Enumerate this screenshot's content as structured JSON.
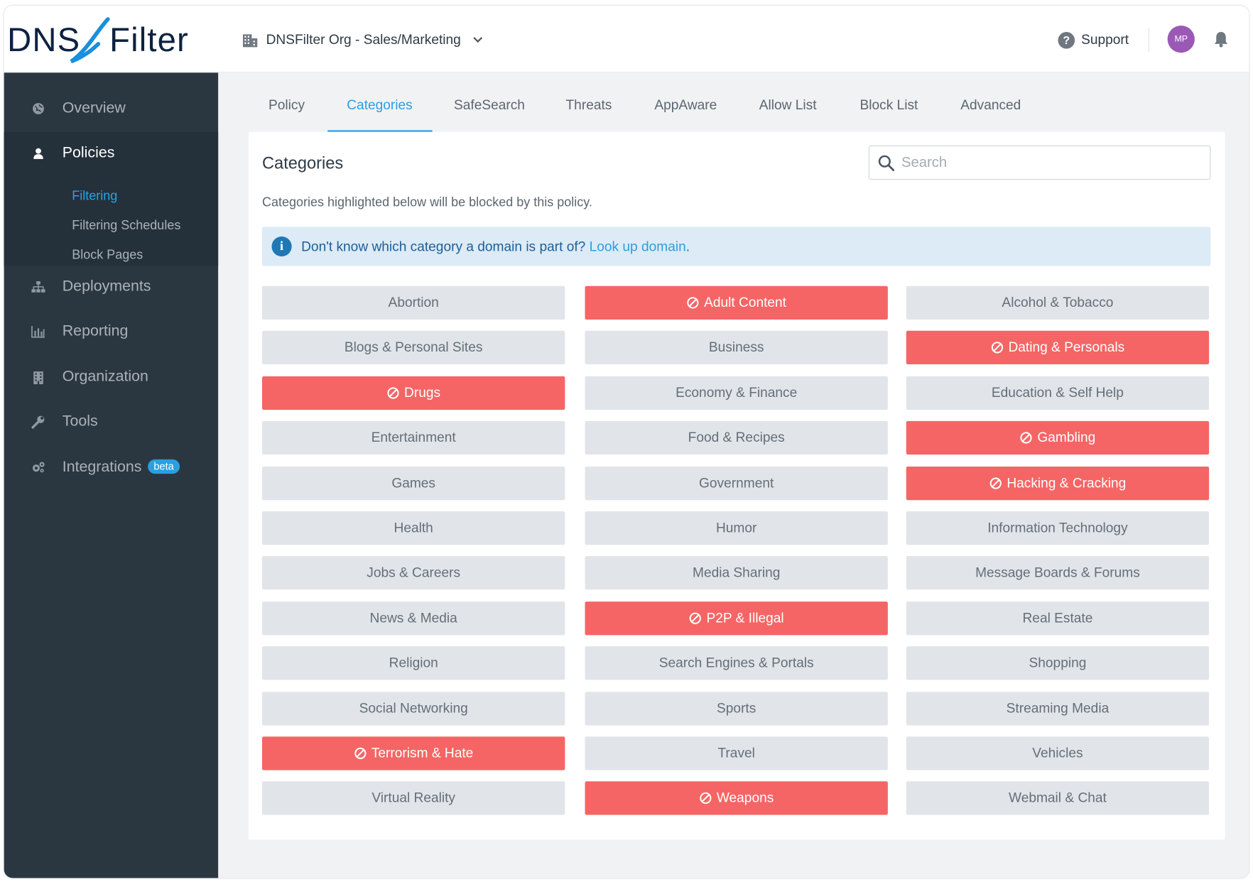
{
  "header": {
    "logo_text": "DNSFilter",
    "org_name": "DNSFilter Org - Sales/Marketing",
    "support_label": "Support",
    "avatar_initials": "MP",
    "avatar_color": "#9b59b6"
  },
  "sidebar": {
    "items": [
      {
        "label": "Overview",
        "icon": "globe-icon"
      },
      {
        "label": "Policies",
        "icon": "user-icon"
      },
      {
        "label": "Deployments",
        "icon": "sitemap-icon"
      },
      {
        "label": "Reporting",
        "icon": "bar-chart-icon"
      },
      {
        "label": "Organization",
        "icon": "building-icon"
      },
      {
        "label": "Tools",
        "icon": "wrench-icon"
      },
      {
        "label": "Integrations",
        "icon": "cogs-icon",
        "badge": "beta"
      }
    ],
    "sub_items": [
      "Filtering",
      "Filtering Schedules",
      "Block Pages"
    ],
    "active_item": "Policies",
    "active_sub_item": "Filtering"
  },
  "tabs": [
    "Policy",
    "Categories",
    "SafeSearch",
    "Threats",
    "AppAware",
    "Allow List",
    "Block List",
    "Advanced"
  ],
  "active_tab": "Categories",
  "main": {
    "title": "Categories",
    "search_placeholder": "Search",
    "description": "Categories highlighted below will be blocked by this policy.",
    "info_text": "Don't know which category a domain is part of?",
    "info_link": "Look up domain",
    "info_period": "."
  },
  "colors": {
    "accent": "#2a9fe1",
    "blocked": "#f56565",
    "sidebar": "#2b3740"
  },
  "categories": [
    {
      "label": "Abortion",
      "blocked": false
    },
    {
      "label": "Adult Content",
      "blocked": true
    },
    {
      "label": "Alcohol & Tobacco",
      "blocked": false
    },
    {
      "label": "Blogs & Personal Sites",
      "blocked": false
    },
    {
      "label": "Business",
      "blocked": false
    },
    {
      "label": "Dating & Personals",
      "blocked": true
    },
    {
      "label": "Drugs",
      "blocked": true
    },
    {
      "label": "Economy & Finance",
      "blocked": false
    },
    {
      "label": "Education & Self Help",
      "blocked": false
    },
    {
      "label": "Entertainment",
      "blocked": false
    },
    {
      "label": "Food & Recipes",
      "blocked": false
    },
    {
      "label": "Gambling",
      "blocked": true
    },
    {
      "label": "Games",
      "blocked": false
    },
    {
      "label": "Government",
      "blocked": false
    },
    {
      "label": "Hacking & Cracking",
      "blocked": true
    },
    {
      "label": "Health",
      "blocked": false
    },
    {
      "label": "Humor",
      "blocked": false
    },
    {
      "label": "Information Technology",
      "blocked": false
    },
    {
      "label": "Jobs & Careers",
      "blocked": false
    },
    {
      "label": "Media Sharing",
      "blocked": false
    },
    {
      "label": "Message Boards & Forums",
      "blocked": false
    },
    {
      "label": "News & Media",
      "blocked": false
    },
    {
      "label": "P2P & Illegal",
      "blocked": true
    },
    {
      "label": "Real Estate",
      "blocked": false
    },
    {
      "label": "Religion",
      "blocked": false
    },
    {
      "label": "Search Engines & Portals",
      "blocked": false
    },
    {
      "label": "Shopping",
      "blocked": false
    },
    {
      "label": "Social Networking",
      "blocked": false
    },
    {
      "label": "Sports",
      "blocked": false
    },
    {
      "label": "Streaming Media",
      "blocked": false
    },
    {
      "label": "Terrorism & Hate",
      "blocked": true
    },
    {
      "label": "Travel",
      "blocked": false
    },
    {
      "label": "Vehicles",
      "blocked": false
    },
    {
      "label": "Virtual Reality",
      "blocked": false
    },
    {
      "label": "Weapons",
      "blocked": true
    },
    {
      "label": "Webmail & Chat",
      "blocked": false
    }
  ]
}
